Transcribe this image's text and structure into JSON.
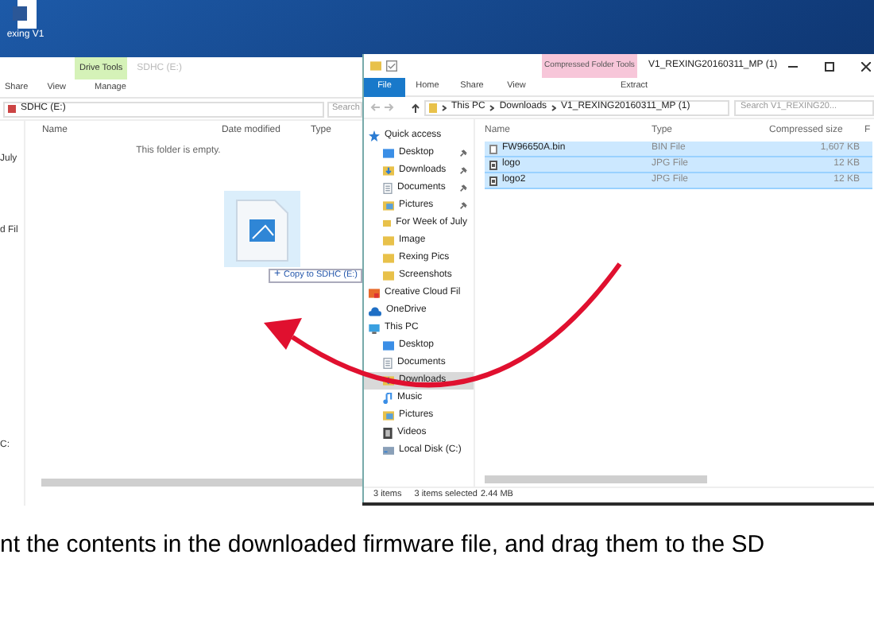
{
  "desktop_icon": {
    "label": "exing V1"
  },
  "left_window": {
    "context_tab": "Drive Tools",
    "title": "SDHC (E:)",
    "ribbon_tabs": [
      "Share",
      "View",
      "Manage"
    ],
    "address": "SDHC (E:)",
    "search": {
      "placeholder": "Search"
    },
    "nav_items": [
      "July",
      "d Fil",
      "C:"
    ],
    "columns": [
      "Name",
      "Date modified",
      "Type"
    ],
    "empty_message": "This folder is empty.",
    "drag_tooltip": {
      "symbol": "+",
      "text": "Copy to SDHC (E:)"
    }
  },
  "right_window": {
    "context_tab": "Compressed Folder Tools",
    "title": "V1_REXING20160311_MP (1)",
    "ribbon_tabs": [
      {
        "label": "File",
        "selected": true
      },
      {
        "label": "Home",
        "selected": false
      },
      {
        "label": "Share",
        "selected": false
      },
      {
        "label": "View",
        "selected": false
      },
      {
        "label": "Extract",
        "selected": false
      }
    ],
    "breadcrumb": [
      "This PC",
      "Downloads",
      "V1_REXING20160311_MP (1)"
    ],
    "search": {
      "placeholder": "Search V1_REXING20..."
    },
    "nav": [
      {
        "label": "Quick access",
        "kind": "star",
        "selected": false,
        "children": [
          {
            "label": "Desktop",
            "kind": "folder-blue",
            "pinned": true,
            "selected": false
          },
          {
            "label": "Downloads",
            "kind": "download",
            "pinned": true,
            "selected": false
          },
          {
            "label": "Documents",
            "kind": "document",
            "pinned": true,
            "selected": false
          },
          {
            "label": "Pictures",
            "kind": "pictures",
            "pinned": true,
            "selected": false
          },
          {
            "label": "For Week of July",
            "kind": "folder",
            "pinned": false,
            "selected": false
          },
          {
            "label": "Image",
            "kind": "folder",
            "pinned": false,
            "selected": false
          },
          {
            "label": "Rexing Pics",
            "kind": "folder",
            "pinned": false,
            "selected": false
          },
          {
            "label": "Screenshots",
            "kind": "folder",
            "pinned": false,
            "selected": false
          }
        ]
      },
      {
        "label": "Creative Cloud Fil",
        "kind": "cloud-folder",
        "selected": false
      },
      {
        "label": "OneDrive",
        "kind": "cloud",
        "selected": false
      },
      {
        "label": "This PC",
        "kind": "pc",
        "selected": false,
        "children": [
          {
            "label": "Desktop",
            "kind": "folder-blue",
            "pinned": false,
            "selected": false
          },
          {
            "label": "Documents",
            "kind": "document",
            "pinned": false,
            "selected": false
          },
          {
            "label": "Downloads",
            "kind": "download",
            "pinned": false,
            "selected": true
          },
          {
            "label": "Music",
            "kind": "music",
            "pinned": false,
            "selected": false
          },
          {
            "label": "Pictures",
            "kind": "pictures",
            "pinned": false,
            "selected": false
          },
          {
            "label": "Videos",
            "kind": "video",
            "pinned": false,
            "selected": false
          },
          {
            "label": "Local Disk (C:)",
            "kind": "disk",
            "pinned": false,
            "selected": false
          }
        ]
      }
    ],
    "columns": [
      "Name",
      "Type",
      "Compressed size",
      "F"
    ],
    "rows": [
      {
        "name": "FW96650A.bin",
        "kind": "file",
        "type": "BIN File",
        "size": "1,607 KB",
        "selected": true
      },
      {
        "name": "logo",
        "kind": "image",
        "type": "JPG File",
        "size": "12 KB",
        "selected": true
      },
      {
        "name": "logo2",
        "kind": "image",
        "type": "JPG File",
        "size": "12 KB",
        "selected": true
      }
    ],
    "status": {
      "count": "3 items",
      "selection": "3 items selected",
      "size": "2.44 MB"
    }
  },
  "caption": "nt the contents in the downloaded firmware file, and drag them to the SD"
}
